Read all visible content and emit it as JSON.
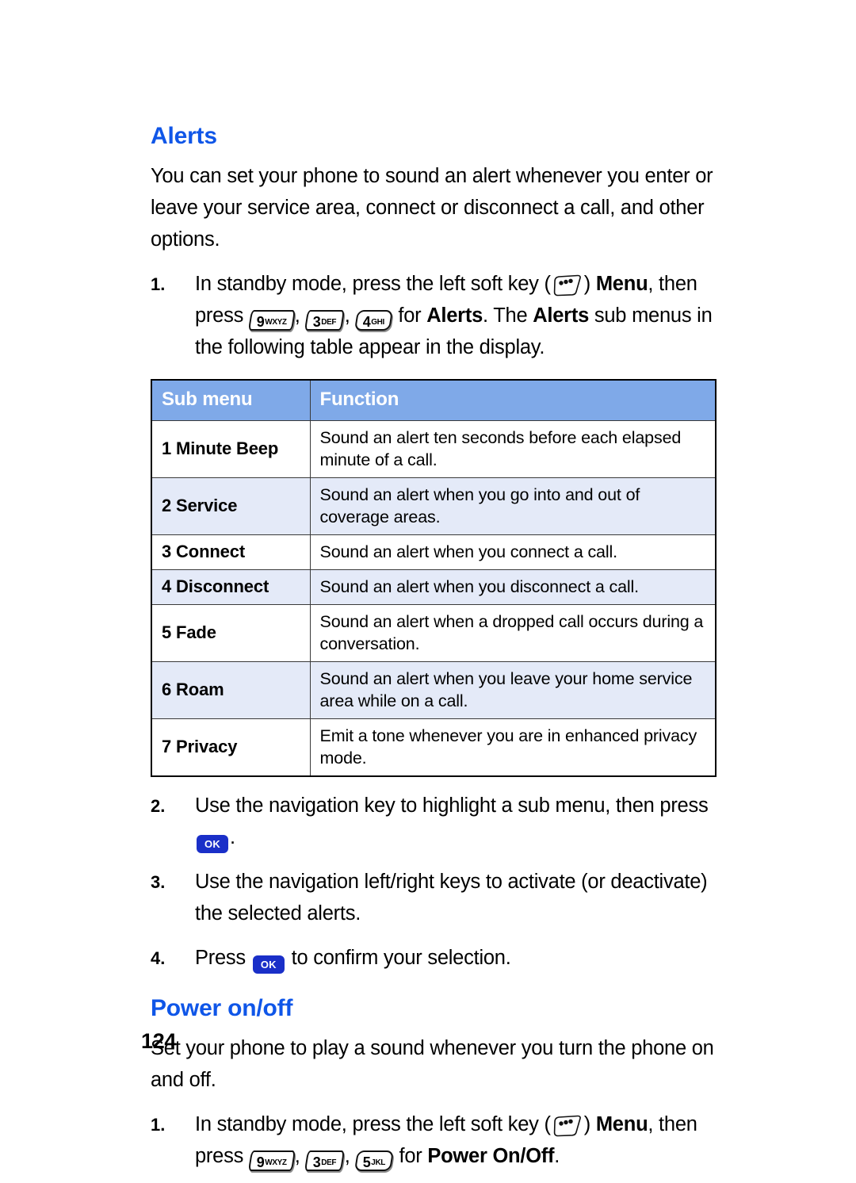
{
  "document": {
    "page_number": "124",
    "heading_color": "#0f56e8",
    "table_header_bg": "#7fa9e8",
    "table_alt_row_bg": "#e4eaf8",
    "ok_key_color": "#1a2fc8"
  },
  "alerts_section": {
    "heading": "Alerts",
    "intro": "You can set your phone to sound an alert whenever you enter or leave your service area, connect or disconnect a call, and other options.",
    "steps": [
      {
        "number": "1.",
        "parts": [
          {
            "type": "text",
            "value": "In standby mode, press the left soft key ("
          },
          {
            "type": "softkey",
            "value": "left-soft-key"
          },
          {
            "type": "text",
            "value": ") "
          },
          {
            "type": "bold",
            "value": "Menu"
          },
          {
            "type": "text",
            "value": ", then press "
          },
          {
            "type": "key",
            "digit": "9",
            "letters": "WXYZ"
          },
          {
            "type": "text",
            "value": ", "
          },
          {
            "type": "key",
            "digit": "3",
            "letters": "DEF"
          },
          {
            "type": "text",
            "value": ", "
          },
          {
            "type": "key",
            "digit": "4",
            "letters": "GHI"
          },
          {
            "type": "text",
            "value": " for "
          },
          {
            "type": "bold",
            "value": "Alerts"
          },
          {
            "type": "text",
            "value": ". The "
          },
          {
            "type": "bold",
            "value": "Alerts"
          },
          {
            "type": "text",
            "value": " sub menus in the following table appear in the display."
          }
        ]
      },
      {
        "number": "2.",
        "parts": [
          {
            "type": "text",
            "value": "Use the navigation key to highlight a sub menu, then press "
          },
          {
            "type": "okkey",
            "value": "OK"
          },
          {
            "type": "text",
            "value": "."
          }
        ]
      },
      {
        "number": "3.",
        "parts": [
          {
            "type": "text",
            "value": "Use the navigation left/right keys to activate (or deactivate) the selected alerts."
          }
        ]
      },
      {
        "number": "4.",
        "parts": [
          {
            "type": "text",
            "value": "Press "
          },
          {
            "type": "okkey",
            "value": "OK"
          },
          {
            "type": "text",
            "value": " to confirm your selection."
          }
        ]
      }
    ],
    "table": {
      "headers": [
        "Sub menu",
        "Function"
      ],
      "rows": [
        {
          "sub_menu": "1 Minute Beep",
          "function": "Sound an alert ten seconds before each elapsed minute of a call."
        },
        {
          "sub_menu": "2 Service",
          "function": "Sound an alert when you go into and out of coverage areas."
        },
        {
          "sub_menu": "3 Connect",
          "function": "Sound an alert when you connect a call."
        },
        {
          "sub_menu": "4 Disconnect",
          "function": "Sound an alert when you disconnect a call."
        },
        {
          "sub_menu": "5 Fade",
          "function": "Sound an alert when a dropped call occurs during a conversation."
        },
        {
          "sub_menu": "6 Roam",
          "function": "Sound an alert when you leave your home service area while on a call."
        },
        {
          "sub_menu": "7 Privacy",
          "function": "Emit a tone whenever you are in enhanced privacy mode."
        }
      ]
    }
  },
  "power_section": {
    "heading": "Power on/off",
    "intro": "Set your phone to play a sound whenever you turn the phone on and off.",
    "steps": [
      {
        "number": "1.",
        "parts": [
          {
            "type": "text",
            "value": "In standby mode, press the left soft key ("
          },
          {
            "type": "softkey",
            "value": "left-soft-key"
          },
          {
            "type": "text",
            "value": ") "
          },
          {
            "type": "bold",
            "value": "Menu"
          },
          {
            "type": "text",
            "value": ", then press "
          },
          {
            "type": "key",
            "digit": "9",
            "letters": "WXYZ"
          },
          {
            "type": "text",
            "value": ", "
          },
          {
            "type": "key",
            "digit": "3",
            "letters": "DEF"
          },
          {
            "type": "text",
            "value": ", "
          },
          {
            "type": "key",
            "digit": "5",
            "letters": "JKL"
          },
          {
            "type": "text",
            "value": " for "
          },
          {
            "type": "bold",
            "value": "Power On/Off"
          },
          {
            "type": "text",
            "value": "."
          }
        ]
      }
    ]
  }
}
